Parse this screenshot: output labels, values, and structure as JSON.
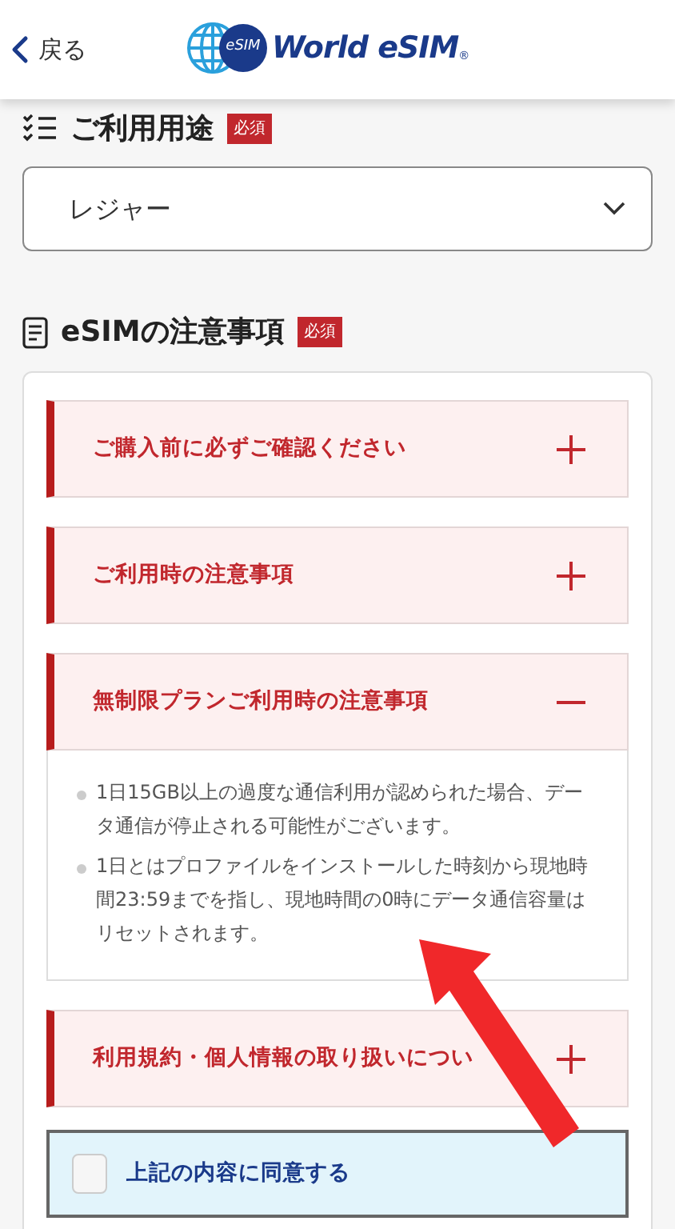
{
  "header": {
    "back_label": "戻る",
    "logo": {
      "badge": "eSIM",
      "name": "World eSIM",
      "mark": "®"
    }
  },
  "usage": {
    "title": "ご利用用途",
    "badge": "必須",
    "select": {
      "value": "レジャー"
    }
  },
  "notes": {
    "title": "eSIMの注意事項",
    "badge": "必須",
    "sections": [
      {
        "title": "ご購入前に必ずご確認ください",
        "expanded": false
      },
      {
        "title": "ご利用時の注意事項",
        "expanded": false
      },
      {
        "title": "無制限プランご利用時の注意事項",
        "expanded": true,
        "items": [
          "1日15GB以上の過度な通信利用が認められた場合、データ通信が停止される可能性がございます。",
          "1日とはプロファイルをインストールした時刻から現地時間23:59までを指し、現地時間の0時にデータ通信容量はリセットされます。"
        ]
      },
      {
        "title": "利用規約・個人情報の取り扱いについ",
        "expanded": false
      }
    ]
  },
  "agree": {
    "label": "上記の内容に同意する",
    "checked": false
  }
}
